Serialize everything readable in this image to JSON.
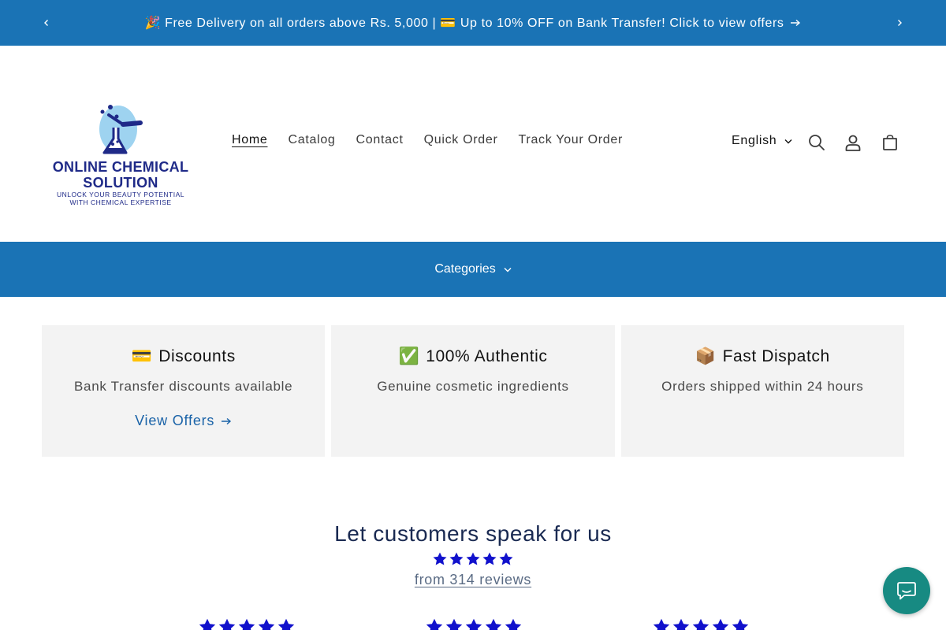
{
  "announcement": {
    "text": "🎉 Free Delivery on all orders above Rs. 5,000 | 💳 Up to 10% OFF on Bank Transfer! Click to view offers",
    "bg_color": "#1a73b5"
  },
  "logo": {
    "name_line1": "ONLINE CHEMICAL",
    "name_line2": "SOLUTION",
    "tagline_line1": "UNLOCK YOUR BEAUTY POTENTIAL",
    "tagline_line2": "WITH CHEMICAL EXPERTISE"
  },
  "nav": {
    "items": [
      {
        "label": "Home",
        "active": true
      },
      {
        "label": "Catalog"
      },
      {
        "label": "Contact"
      },
      {
        "label": "Quick Order"
      },
      {
        "label": "Track Your Order"
      }
    ]
  },
  "header_actions": {
    "language": "English",
    "icons": [
      "search-icon",
      "account-icon",
      "cart-icon"
    ]
  },
  "categories": {
    "label": "Categories"
  },
  "features": [
    {
      "emoji": "💳",
      "title": "Discounts",
      "desc": "Bank Transfer discounts available",
      "link": "View Offers"
    },
    {
      "emoji": "✅",
      "title": "100% Authentic",
      "desc": "Genuine cosmetic ingredients"
    },
    {
      "emoji": "📦",
      "title": "Fast Dispatch",
      "desc": "Orders shipped within 24 hours"
    }
  ],
  "reviews": {
    "title": "Let customers speak for us",
    "rating": 5,
    "count_text": "from 314 reviews",
    "star_color": "#1111cc"
  },
  "colors": {
    "accent": "#1a73b5",
    "chat": "#178a82",
    "logo_navy": "#1f2a88"
  }
}
